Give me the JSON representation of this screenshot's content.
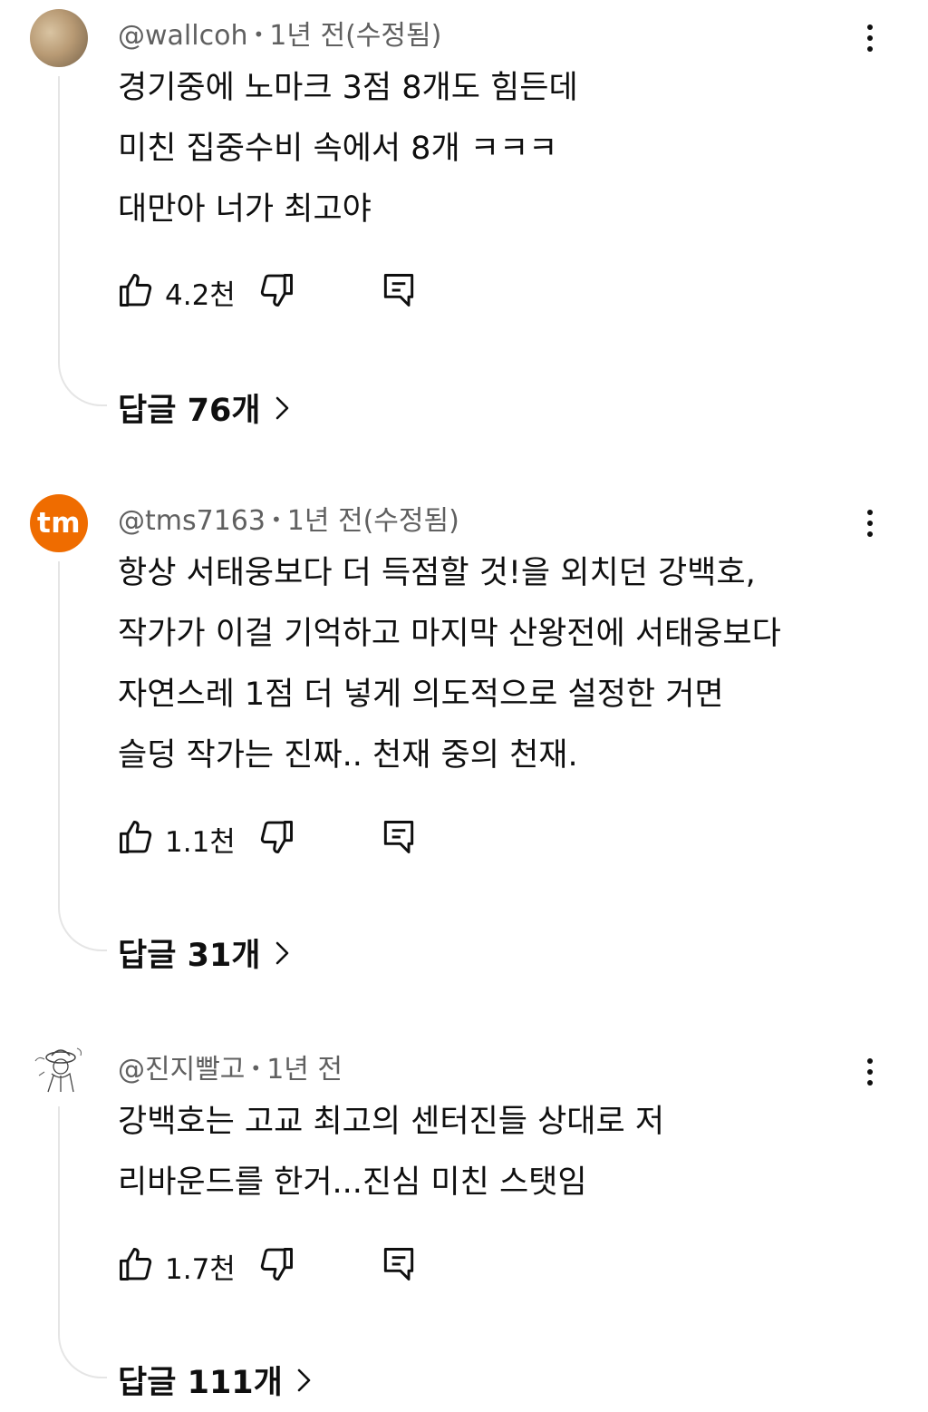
{
  "comments": [
    {
      "handle": "@wallcoh",
      "time": "1년 전(수정됨)",
      "lines": [
        "경기중에 노마크 3점 8개도 힘든데",
        "미친 집중수비 속에서 8개 ㅋㅋㅋ",
        "대만아 너가 최고야"
      ],
      "likes": "4.2천",
      "replies": "답글 76개"
    },
    {
      "handle": "@tms7163",
      "time": "1년 전(수정됨)",
      "avatar_text": "tm",
      "lines": [
        "항상 서태웅보다 더 득점할 것!을 외치던 강백호,",
        "작가가 이걸 기억하고 마지막 산왕전에 서태웅보다",
        "자연스레 1점 더 넣게 의도적으로 설정한 거면",
        "슬덩 작가는 진짜.. 천재 중의 천재."
      ],
      "likes": "1.1천",
      "replies": "답글 31개"
    },
    {
      "handle": "@진지빨고",
      "time": "1년 전",
      "lines": [
        "강백호는 고교 최고의 센터진들 상대로 저",
        "리바운드를 한거...진심 미친 스탯임"
      ],
      "likes": "1.7천",
      "replies": "답글 111개"
    }
  ],
  "separator": "•",
  "icons": {
    "like": "thumbs-up-icon",
    "dislike": "thumbs-down-icon",
    "reply": "reply-comment-icon",
    "menu": "more-vert-icon",
    "chevron": "chevron-right-icon"
  },
  "colors": {
    "avatar_tm": "#ef6c00",
    "meta_text": "#606060",
    "text": "#0f0f0f",
    "thread_line": "#e5e5e5"
  }
}
